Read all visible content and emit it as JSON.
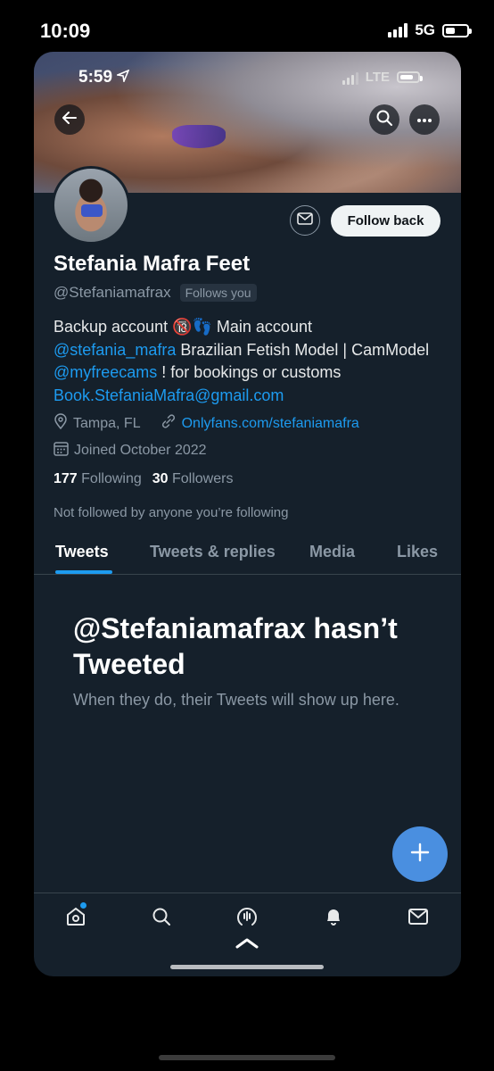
{
  "outer_status": {
    "time": "10:09",
    "network": "5G"
  },
  "inner_status": {
    "time": "5:59",
    "network": "LTE"
  },
  "profile": {
    "display_name": "Stefania Mafra Feet",
    "handle": "@Stefaniamafrax",
    "follows_you": "Follows you",
    "follow_back_label": "Follow back",
    "bio": {
      "p1": "Backup account 🔞👣 Main account ",
      "mention1": "@stefania_mafra",
      "p2": " Brazilian Fetish Model | CamModel ",
      "mention2": "@myfreecams",
      "p3": " ! for bookings or customs ",
      "email": "Book.StefaniaMafra@gmail.com"
    },
    "location": "Tampa, FL",
    "website": "Onlyfans.com/stefaniamafra",
    "joined": "Joined October 2022",
    "following_count": "177",
    "following_label": "Following",
    "followers_count": "30",
    "followers_label": "Followers",
    "not_followed": "Not followed by anyone you’re following"
  },
  "tabs": [
    {
      "label": "Tweets",
      "active": true
    },
    {
      "label": "Tweets & replies",
      "active": false
    },
    {
      "label": "Media",
      "active": false
    },
    {
      "label": "Likes",
      "active": false
    }
  ],
  "empty_state": {
    "title": "@Stefaniamafrax hasn’t Tweeted",
    "subtitle": "When they do, their Tweets will show up here."
  },
  "icons": {
    "back": "back-arrow-icon",
    "search": "search-icon",
    "more": "more-icon",
    "message": "mail-icon",
    "location": "location-pin-icon",
    "link": "link-icon",
    "calendar": "calendar-icon",
    "compose": "plus-icon",
    "nav": [
      "home-icon",
      "search-icon",
      "spaces-icon",
      "bell-icon",
      "mail-icon"
    ]
  },
  "colors": {
    "background": "#15202b",
    "accent": "#1d9bf0",
    "fab": "#4a8fe0",
    "muted": "#8b98a5"
  }
}
